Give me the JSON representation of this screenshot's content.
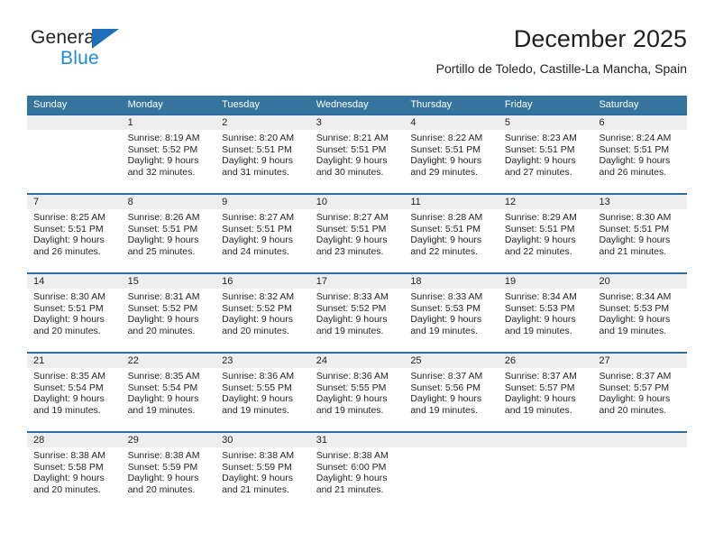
{
  "logo": {
    "word_one": "General",
    "word_two": "Blue",
    "triangle_color": "#1f6fb8",
    "blue_text_color": "#1f8ad6"
  },
  "header": {
    "title": "December 2025",
    "subtitle": "Portillo de Toledo, Castille-La Mancha, Spain"
  },
  "theme": {
    "header_row_bg": "#35749c",
    "week_divider": "#2b6ca3",
    "daynum_band_bg": "#eeeeee",
    "text": "#231f20"
  },
  "weekdays": [
    "Sunday",
    "Monday",
    "Tuesday",
    "Wednesday",
    "Thursday",
    "Friday",
    "Saturday"
  ],
  "weeks": [
    [
      {
        "day": "",
        "sunrise": "",
        "sunset": "",
        "daylight_1": "",
        "daylight_2": ""
      },
      {
        "day": "1",
        "sunrise": "Sunrise: 8:19 AM",
        "sunset": "Sunset: 5:52 PM",
        "daylight_1": "Daylight: 9 hours",
        "daylight_2": "and 32 minutes."
      },
      {
        "day": "2",
        "sunrise": "Sunrise: 8:20 AM",
        "sunset": "Sunset: 5:51 PM",
        "daylight_1": "Daylight: 9 hours",
        "daylight_2": "and 31 minutes."
      },
      {
        "day": "3",
        "sunrise": "Sunrise: 8:21 AM",
        "sunset": "Sunset: 5:51 PM",
        "daylight_1": "Daylight: 9 hours",
        "daylight_2": "and 30 minutes."
      },
      {
        "day": "4",
        "sunrise": "Sunrise: 8:22 AM",
        "sunset": "Sunset: 5:51 PM",
        "daylight_1": "Daylight: 9 hours",
        "daylight_2": "and 29 minutes."
      },
      {
        "day": "5",
        "sunrise": "Sunrise: 8:23 AM",
        "sunset": "Sunset: 5:51 PM",
        "daylight_1": "Daylight: 9 hours",
        "daylight_2": "and 27 minutes."
      },
      {
        "day": "6",
        "sunrise": "Sunrise: 8:24 AM",
        "sunset": "Sunset: 5:51 PM",
        "daylight_1": "Daylight: 9 hours",
        "daylight_2": "and 26 minutes."
      }
    ],
    [
      {
        "day": "7",
        "sunrise": "Sunrise: 8:25 AM",
        "sunset": "Sunset: 5:51 PM",
        "daylight_1": "Daylight: 9 hours",
        "daylight_2": "and 26 minutes."
      },
      {
        "day": "8",
        "sunrise": "Sunrise: 8:26 AM",
        "sunset": "Sunset: 5:51 PM",
        "daylight_1": "Daylight: 9 hours",
        "daylight_2": "and 25 minutes."
      },
      {
        "day": "9",
        "sunrise": "Sunrise: 8:27 AM",
        "sunset": "Sunset: 5:51 PM",
        "daylight_1": "Daylight: 9 hours",
        "daylight_2": "and 24 minutes."
      },
      {
        "day": "10",
        "sunrise": "Sunrise: 8:27 AM",
        "sunset": "Sunset: 5:51 PM",
        "daylight_1": "Daylight: 9 hours",
        "daylight_2": "and 23 minutes."
      },
      {
        "day": "11",
        "sunrise": "Sunrise: 8:28 AM",
        "sunset": "Sunset: 5:51 PM",
        "daylight_1": "Daylight: 9 hours",
        "daylight_2": "and 22 minutes."
      },
      {
        "day": "12",
        "sunrise": "Sunrise: 8:29 AM",
        "sunset": "Sunset: 5:51 PM",
        "daylight_1": "Daylight: 9 hours",
        "daylight_2": "and 22 minutes."
      },
      {
        "day": "13",
        "sunrise": "Sunrise: 8:30 AM",
        "sunset": "Sunset: 5:51 PM",
        "daylight_1": "Daylight: 9 hours",
        "daylight_2": "and 21 minutes."
      }
    ],
    [
      {
        "day": "14",
        "sunrise": "Sunrise: 8:30 AM",
        "sunset": "Sunset: 5:51 PM",
        "daylight_1": "Daylight: 9 hours",
        "daylight_2": "and 20 minutes."
      },
      {
        "day": "15",
        "sunrise": "Sunrise: 8:31 AM",
        "sunset": "Sunset: 5:52 PM",
        "daylight_1": "Daylight: 9 hours",
        "daylight_2": "and 20 minutes."
      },
      {
        "day": "16",
        "sunrise": "Sunrise: 8:32 AM",
        "sunset": "Sunset: 5:52 PM",
        "daylight_1": "Daylight: 9 hours",
        "daylight_2": "and 20 minutes."
      },
      {
        "day": "17",
        "sunrise": "Sunrise: 8:33 AM",
        "sunset": "Sunset: 5:52 PM",
        "daylight_1": "Daylight: 9 hours",
        "daylight_2": "and 19 minutes."
      },
      {
        "day": "18",
        "sunrise": "Sunrise: 8:33 AM",
        "sunset": "Sunset: 5:53 PM",
        "daylight_1": "Daylight: 9 hours",
        "daylight_2": "and 19 minutes."
      },
      {
        "day": "19",
        "sunrise": "Sunrise: 8:34 AM",
        "sunset": "Sunset: 5:53 PM",
        "daylight_1": "Daylight: 9 hours",
        "daylight_2": "and 19 minutes."
      },
      {
        "day": "20",
        "sunrise": "Sunrise: 8:34 AM",
        "sunset": "Sunset: 5:53 PM",
        "daylight_1": "Daylight: 9 hours",
        "daylight_2": "and 19 minutes."
      }
    ],
    [
      {
        "day": "21",
        "sunrise": "Sunrise: 8:35 AM",
        "sunset": "Sunset: 5:54 PM",
        "daylight_1": "Daylight: 9 hours",
        "daylight_2": "and 19 minutes."
      },
      {
        "day": "22",
        "sunrise": "Sunrise: 8:35 AM",
        "sunset": "Sunset: 5:54 PM",
        "daylight_1": "Daylight: 9 hours",
        "daylight_2": "and 19 minutes."
      },
      {
        "day": "23",
        "sunrise": "Sunrise: 8:36 AM",
        "sunset": "Sunset: 5:55 PM",
        "daylight_1": "Daylight: 9 hours",
        "daylight_2": "and 19 minutes."
      },
      {
        "day": "24",
        "sunrise": "Sunrise: 8:36 AM",
        "sunset": "Sunset: 5:55 PM",
        "daylight_1": "Daylight: 9 hours",
        "daylight_2": "and 19 minutes."
      },
      {
        "day": "25",
        "sunrise": "Sunrise: 8:37 AM",
        "sunset": "Sunset: 5:56 PM",
        "daylight_1": "Daylight: 9 hours",
        "daylight_2": "and 19 minutes."
      },
      {
        "day": "26",
        "sunrise": "Sunrise: 8:37 AM",
        "sunset": "Sunset: 5:57 PM",
        "daylight_1": "Daylight: 9 hours",
        "daylight_2": "and 19 minutes."
      },
      {
        "day": "27",
        "sunrise": "Sunrise: 8:37 AM",
        "sunset": "Sunset: 5:57 PM",
        "daylight_1": "Daylight: 9 hours",
        "daylight_2": "and 20 minutes."
      }
    ],
    [
      {
        "day": "28",
        "sunrise": "Sunrise: 8:38 AM",
        "sunset": "Sunset: 5:58 PM",
        "daylight_1": "Daylight: 9 hours",
        "daylight_2": "and 20 minutes."
      },
      {
        "day": "29",
        "sunrise": "Sunrise: 8:38 AM",
        "sunset": "Sunset: 5:59 PM",
        "daylight_1": "Daylight: 9 hours",
        "daylight_2": "and 20 minutes."
      },
      {
        "day": "30",
        "sunrise": "Sunrise: 8:38 AM",
        "sunset": "Sunset: 5:59 PM",
        "daylight_1": "Daylight: 9 hours",
        "daylight_2": "and 21 minutes."
      },
      {
        "day": "31",
        "sunrise": "Sunrise: 8:38 AM",
        "sunset": "Sunset: 6:00 PM",
        "daylight_1": "Daylight: 9 hours",
        "daylight_2": "and 21 minutes."
      },
      {
        "day": "",
        "sunrise": "",
        "sunset": "",
        "daylight_1": "",
        "daylight_2": ""
      },
      {
        "day": "",
        "sunrise": "",
        "sunset": "",
        "daylight_1": "",
        "daylight_2": ""
      },
      {
        "day": "",
        "sunrise": "",
        "sunset": "",
        "daylight_1": "",
        "daylight_2": ""
      }
    ]
  ]
}
